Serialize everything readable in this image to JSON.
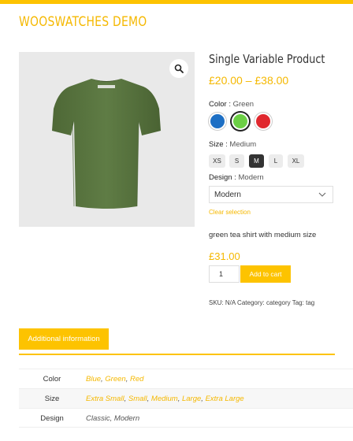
{
  "site": {
    "title": "WOOSWATCHES DEMO",
    "accent": "#fdc300"
  },
  "gallery": {
    "zoom_icon": "magnifier-icon",
    "image": "green-tshirt-back",
    "shirt_color": "#5a7541"
  },
  "product": {
    "title": "Single Variable Product",
    "price_range": "£20.00 – £38.00",
    "description": "green tea shirt with medium size",
    "variation_price": "£31.00",
    "quantity": "1",
    "add_to_cart": "Add to cart"
  },
  "attributes": {
    "color": {
      "label": "Color",
      "selected": "Green",
      "swatches": [
        {
          "name": "Blue",
          "hex": "#1d6fc4"
        },
        {
          "name": "Green",
          "hex": "#6ccf45"
        },
        {
          "name": "Red",
          "hex": "#e0282e"
        }
      ]
    },
    "size": {
      "label": "Size",
      "selected": "Medium",
      "options": [
        "XS",
        "S",
        "M",
        "L",
        "XL"
      ],
      "selected_option": "M"
    },
    "design": {
      "label": "Design",
      "selected": "Modern",
      "select_value": "Modern"
    },
    "clear_label": "Clear selection"
  },
  "meta": {
    "sku_label": "SKU:",
    "sku": "N/A",
    "category_label": "Category:",
    "category": "category",
    "tag_label": "Tag:",
    "tag": "tag"
  },
  "tabs": {
    "active": "Additional information"
  },
  "info_table": {
    "rows": [
      {
        "key": "Color",
        "values": [
          "Blue",
          "Green",
          "Red"
        ],
        "linked": true
      },
      {
        "key": "Size",
        "values": [
          "Extra Small",
          "Small",
          "Medium",
          "Large",
          "Extra Large"
        ],
        "linked": true
      },
      {
        "key": "Design",
        "values": [
          "Classic",
          "Modern"
        ],
        "linked": false
      }
    ]
  }
}
